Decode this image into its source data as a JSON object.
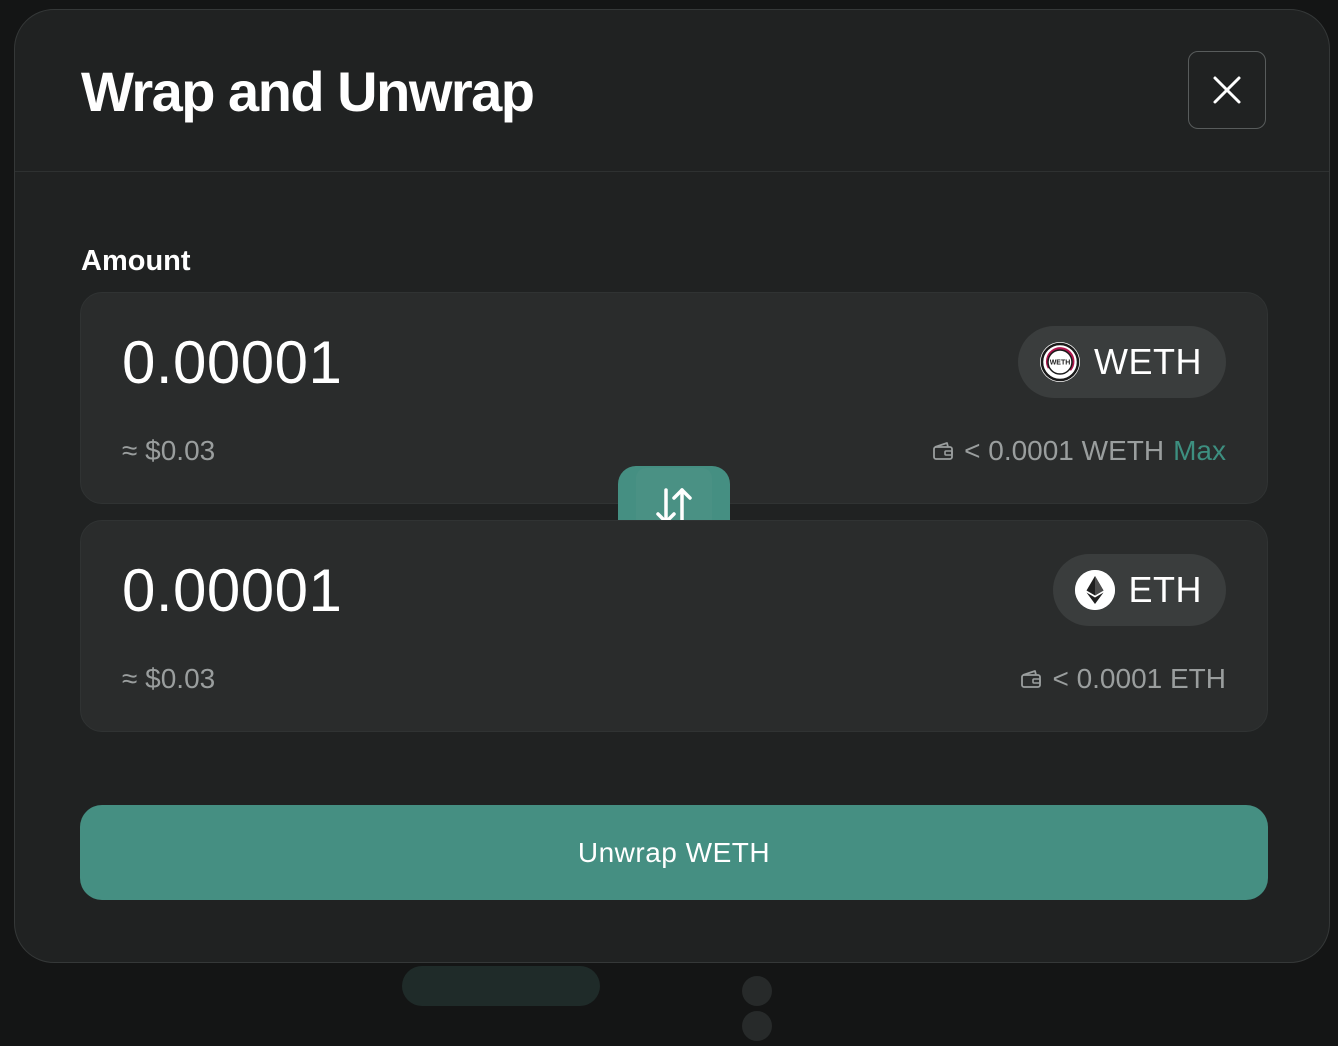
{
  "modal": {
    "title": "Wrap and Unwrap",
    "close_icon": "close-icon"
  },
  "amount_section": {
    "label": "Amount"
  },
  "from_token": {
    "amount": "0.00001",
    "usd_value": "≈ $0.03",
    "symbol": "WETH",
    "logo_icon": "weth-logo-icon",
    "logo_text": "WETH",
    "balance": "< 0.0001 WETH",
    "max_label": "Max"
  },
  "swap_direction": {
    "icon": "swap-vertical-arrows-icon"
  },
  "to_token": {
    "amount": "0.00001",
    "usd_value": "≈ $0.03",
    "symbol": "ETH",
    "logo_icon": "eth-logo-icon",
    "balance": "< 0.0001 ETH"
  },
  "submit": {
    "label": "Unwrap WETH"
  },
  "colors": {
    "accent": "#458f82",
    "max_link": "#3d8f80",
    "modal_bg": "#202222",
    "card_bg": "#2a2c2c",
    "muted_text": "#9a9e9e"
  }
}
